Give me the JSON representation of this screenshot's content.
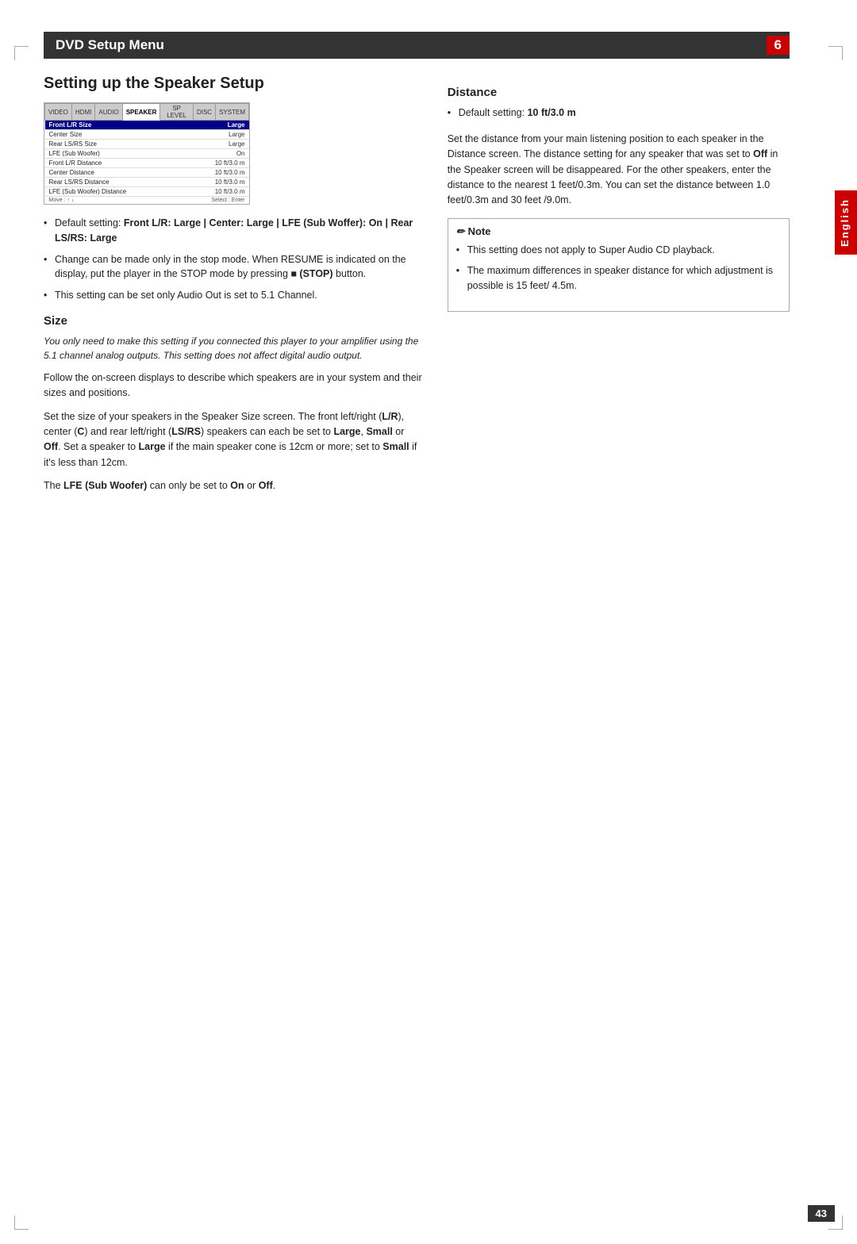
{
  "page": {
    "number": "43",
    "language_label": "English"
  },
  "header": {
    "title": "DVD Setup Menu",
    "page_num": "6"
  },
  "left_column": {
    "section_title": "Setting up the Speaker Setup",
    "screenshot": {
      "tabs": [
        "VIDEO",
        "HDMI",
        "AUDIO",
        "SPEAKER",
        "SP LEVEL",
        "DISC",
        "SYSTEM"
      ],
      "active_tab": "SPEAKER",
      "rows": [
        {
          "label": "Front L/R Size",
          "value": "Large",
          "highlight": true
        },
        {
          "label": "Center Size",
          "value": "Large",
          "highlight": false
        },
        {
          "label": "Rear LS/RS Size",
          "value": "Large",
          "highlight": false
        },
        {
          "label": "LFE (Sub Woofer)",
          "value": "On",
          "highlight": false
        },
        {
          "label": "Front L/R Distance",
          "value": "10 ft/3.0 m",
          "highlight": false
        },
        {
          "label": "Center Distance",
          "value": "10 ft/3.0 m",
          "highlight": false
        },
        {
          "label": "Rear LS/RS Distance",
          "value": "10 ft/3.0 m",
          "highlight": false
        },
        {
          "label": "LFE (Sub Woofer) Distance",
          "value": "10 ft/3.0 m",
          "highlight": false
        }
      ],
      "footer_left": "Move : ↑ ↓",
      "footer_right": "Select : Enter"
    },
    "bullets": [
      {
        "text_html": "Default setting: <b>Front L/R: Large | Center: Large | LFE (Sub Woffer): On | Rear LS/RS: Large</b>"
      },
      {
        "text_html": "Change can be made only in the stop mode. When RESUME is indicated on the display, put the player in the STOP mode by pressing ■ <b>(STOP)</b> button."
      },
      {
        "text_html": "This setting can be set only Audio Out is set to 5.1 Channel."
      }
    ],
    "size_section": {
      "title": "Size",
      "italic_para": "You only need to make this setting if you connected this player to your amplifier using the 5.1 channel analog outputs. This setting does not affect digital audio output.",
      "paras": [
        "Follow the on-screen displays to describe which speakers are in your system and their sizes and positions.",
        "Set the size of your speakers in the Speaker Size screen. The front left/right (<b>L/R</b>), center (<b>C</b>) and rear left/right (<b>LS/RS</b>) speakers can each be set to <b>Large</b>, <b>Small</b> or <b>Off</b>. Set a speaker to <b>Large</b> if the main speaker cone is 12cm or more; set to <b>Small</b> if it's less than 12cm.",
        "The <b>LFE (Sub Woofer)</b> can only be set to <b>On</b> or <b>Off</b>."
      ]
    }
  },
  "right_column": {
    "distance_section": {
      "title": "Distance",
      "default_setting": "Default setting: <b>10 ft/3.0 m</b>",
      "paras": [
        "Set the distance from your main listening position to each speaker in the Distance screen. The distance setting for any speaker that was set to <b>Off</b> in the Speaker screen will be disappeared. For the other speakers, enter the distance to the nearest 1 feet/0.3m. You can set the distance between 1.0 feet/0.3m and 30 feet /9.0m."
      ]
    },
    "note_section": {
      "title": "Note",
      "bullets": [
        "This setting does not apply to Super Audio CD playback.",
        "The maximum differences in speaker distance for which adjustment is possible is 15 feet/ 4.5m."
      ]
    }
  }
}
